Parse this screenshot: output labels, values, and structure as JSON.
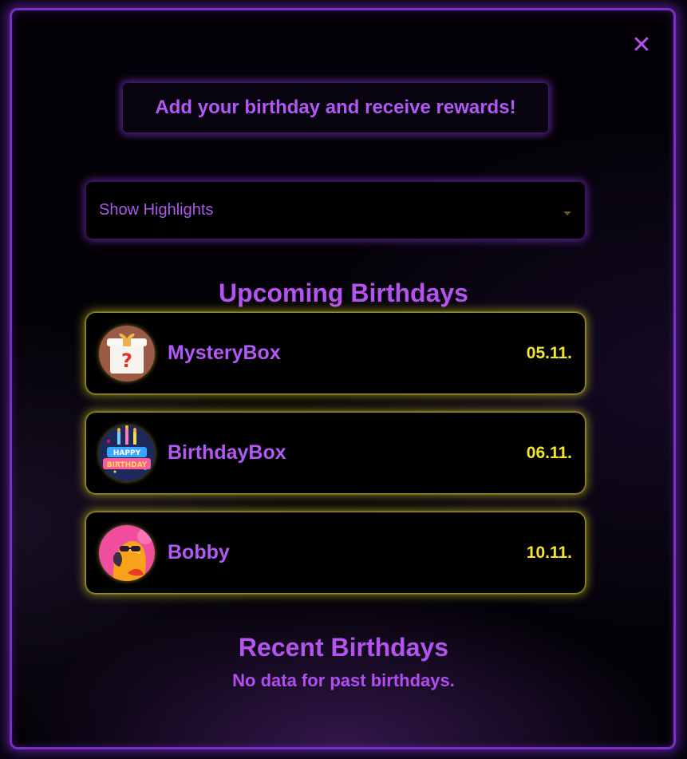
{
  "modal": {
    "close_glyph": "✕",
    "cta_label": "Add your birthday and receive rewards!",
    "filter": {
      "selected": "Show Highlights"
    },
    "upcoming_title": "Upcoming Birthdays",
    "upcoming": [
      {
        "name": "MysteryBox",
        "date": "05.11.",
        "avatar_icon": "mystery-box-icon"
      },
      {
        "name": "BirthdayBox",
        "date": "06.11.",
        "avatar_icon": "happy-birthday-icon"
      },
      {
        "name": "Bobby",
        "date": "10.11.",
        "avatar_icon": "parrot-avatar-icon"
      }
    ],
    "recent_title": "Recent Birthdays",
    "recent_empty": "No data for past birthdays."
  },
  "colors": {
    "accent": "#b258f5",
    "date": "#f3e62a",
    "glow_purple": "#8c32e6",
    "glow_yellow": "#dcd228"
  }
}
